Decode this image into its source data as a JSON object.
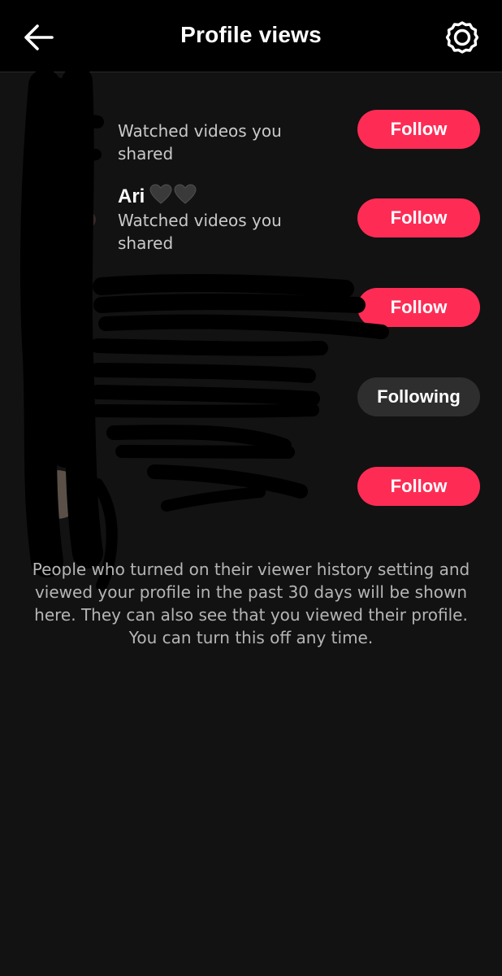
{
  "header": {
    "title": "Profile views",
    "back_icon": "back-arrow-icon",
    "settings_icon": "gear-icon"
  },
  "rows": [
    {
      "name": "",
      "subtitle": "Watched videos you shared",
      "button": "Follow",
      "button_state": "follow"
    },
    {
      "name": "Ari",
      "subtitle": "Watched videos you shared",
      "button": "Follow",
      "button_state": "follow"
    },
    {
      "name": "",
      "subtitle": "",
      "button": "Follow",
      "button_state": "follow"
    },
    {
      "name": "",
      "subtitle": "",
      "button": "Following",
      "button_state": "following"
    },
    {
      "name": "",
      "subtitle": "",
      "button": "Follow",
      "button_state": "follow"
    }
  ],
  "footnote": "People who turned on their viewer history setting and viewed your profile in the past 30 days will be shown here. They can also see that you viewed their profile. You can turn this off any time.",
  "colors": {
    "background": "#121212",
    "header_bg": "#000000",
    "follow_button": "#fe2c55",
    "following_button": "#2e2e2e",
    "secondary_text": "#c9c9c9"
  }
}
